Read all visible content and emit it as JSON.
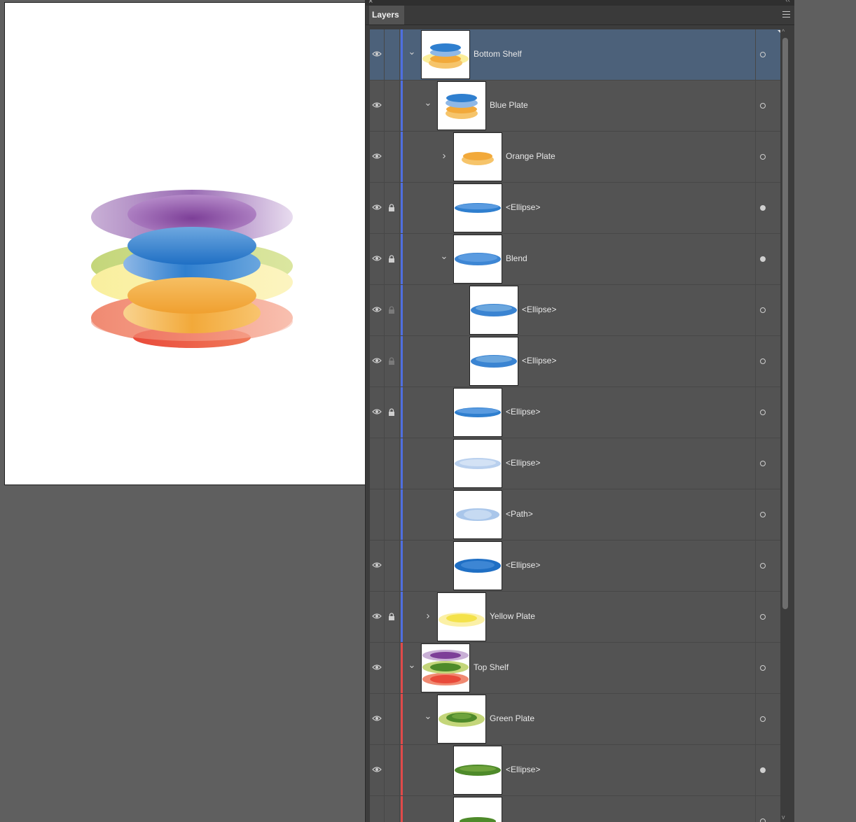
{
  "panel": {
    "tab_label": "Layers",
    "close_icon": "close-icon",
    "menu_icon": "panel-menu-icon"
  },
  "colors": {
    "bottom_shelf_layer_color": "#4f6fe0",
    "top_shelf_layer_color": "#e04a4a",
    "selected_row": "#4c617a"
  },
  "layers": [
    {
      "name": "Bottom Shelf",
      "level": 0,
      "visible": true,
      "locked": false,
      "lock_dim": false,
      "twist": "expanded",
      "thumb": "bottom-shelf",
      "selected": true,
      "target_filled": false,
      "color": "blue"
    },
    {
      "name": "Blue Plate",
      "level": 1,
      "visible": true,
      "locked": false,
      "lock_dim": false,
      "twist": "expanded",
      "thumb": "blue-plate",
      "selected": false,
      "target_filled": false,
      "color": "blue"
    },
    {
      "name": "Orange Plate",
      "level": 2,
      "visible": true,
      "locked": false,
      "lock_dim": false,
      "twist": "collapsed",
      "thumb": "orange-plate",
      "selected": false,
      "target_filled": false,
      "color": "blue"
    },
    {
      "name": "<Ellipse>",
      "level": 2,
      "visible": true,
      "locked": true,
      "lock_dim": false,
      "twist": "none",
      "thumb": "blue-ellipse",
      "selected": false,
      "target_filled": true,
      "color": "blue"
    },
    {
      "name": "Blend",
      "level": 2,
      "visible": true,
      "locked": true,
      "lock_dim": false,
      "twist": "expanded",
      "thumb": "blue-blend",
      "selected": false,
      "target_filled": true,
      "color": "blue"
    },
    {
      "name": "<Ellipse>",
      "level": 3,
      "visible": true,
      "locked": true,
      "lock_dim": true,
      "twist": "none",
      "thumb": "blue-ellipse-mid",
      "selected": false,
      "target_filled": false,
      "color": "blue"
    },
    {
      "name": "<Ellipse>",
      "level": 3,
      "visible": true,
      "locked": true,
      "lock_dim": true,
      "twist": "none",
      "thumb": "blue-ellipse-mid",
      "selected": false,
      "target_filled": false,
      "color": "blue"
    },
    {
      "name": "<Ellipse>",
      "level": 2,
      "visible": true,
      "locked": true,
      "lock_dim": false,
      "twist": "none",
      "thumb": "blue-ellipse",
      "selected": false,
      "target_filled": false,
      "color": "blue"
    },
    {
      "name": "<Ellipse>",
      "level": 2,
      "visible": false,
      "locked": false,
      "lock_dim": false,
      "twist": "none",
      "thumb": "light-ellipse",
      "selected": false,
      "target_filled": false,
      "color": "blue"
    },
    {
      "name": "<Path>",
      "level": 2,
      "visible": false,
      "locked": false,
      "lock_dim": false,
      "twist": "none",
      "thumb": "light-path",
      "selected": false,
      "target_filled": false,
      "color": "blue"
    },
    {
      "name": "<Ellipse>",
      "level": 2,
      "visible": true,
      "locked": false,
      "lock_dim": false,
      "twist": "none",
      "thumb": "blue-ellipse-dark",
      "selected": false,
      "target_filled": false,
      "color": "blue"
    },
    {
      "name": "Yellow Plate",
      "level": 1,
      "visible": true,
      "locked": true,
      "lock_dim": false,
      "twist": "collapsed",
      "thumb": "yellow-plate",
      "selected": false,
      "target_filled": false,
      "color": "blue"
    },
    {
      "name": "Top Shelf",
      "level": 0,
      "visible": true,
      "locked": false,
      "lock_dim": false,
      "twist": "expanded",
      "thumb": "top-shelf",
      "selected": false,
      "target_filled": false,
      "color": "red"
    },
    {
      "name": "Green Plate",
      "level": 1,
      "visible": true,
      "locked": false,
      "lock_dim": false,
      "twist": "expanded",
      "thumb": "green-plate",
      "selected": false,
      "target_filled": false,
      "color": "red"
    },
    {
      "name": "<Ellipse>",
      "level": 2,
      "visible": true,
      "locked": false,
      "lock_dim": false,
      "twist": "none",
      "thumb": "green-ellipse",
      "selected": false,
      "target_filled": true,
      "color": "red"
    },
    {
      "name": "",
      "level": 2,
      "visible": false,
      "locked": false,
      "lock_dim": false,
      "twist": "none",
      "thumb": "green-partial",
      "selected": false,
      "target_filled": false,
      "color": "red"
    }
  ]
}
